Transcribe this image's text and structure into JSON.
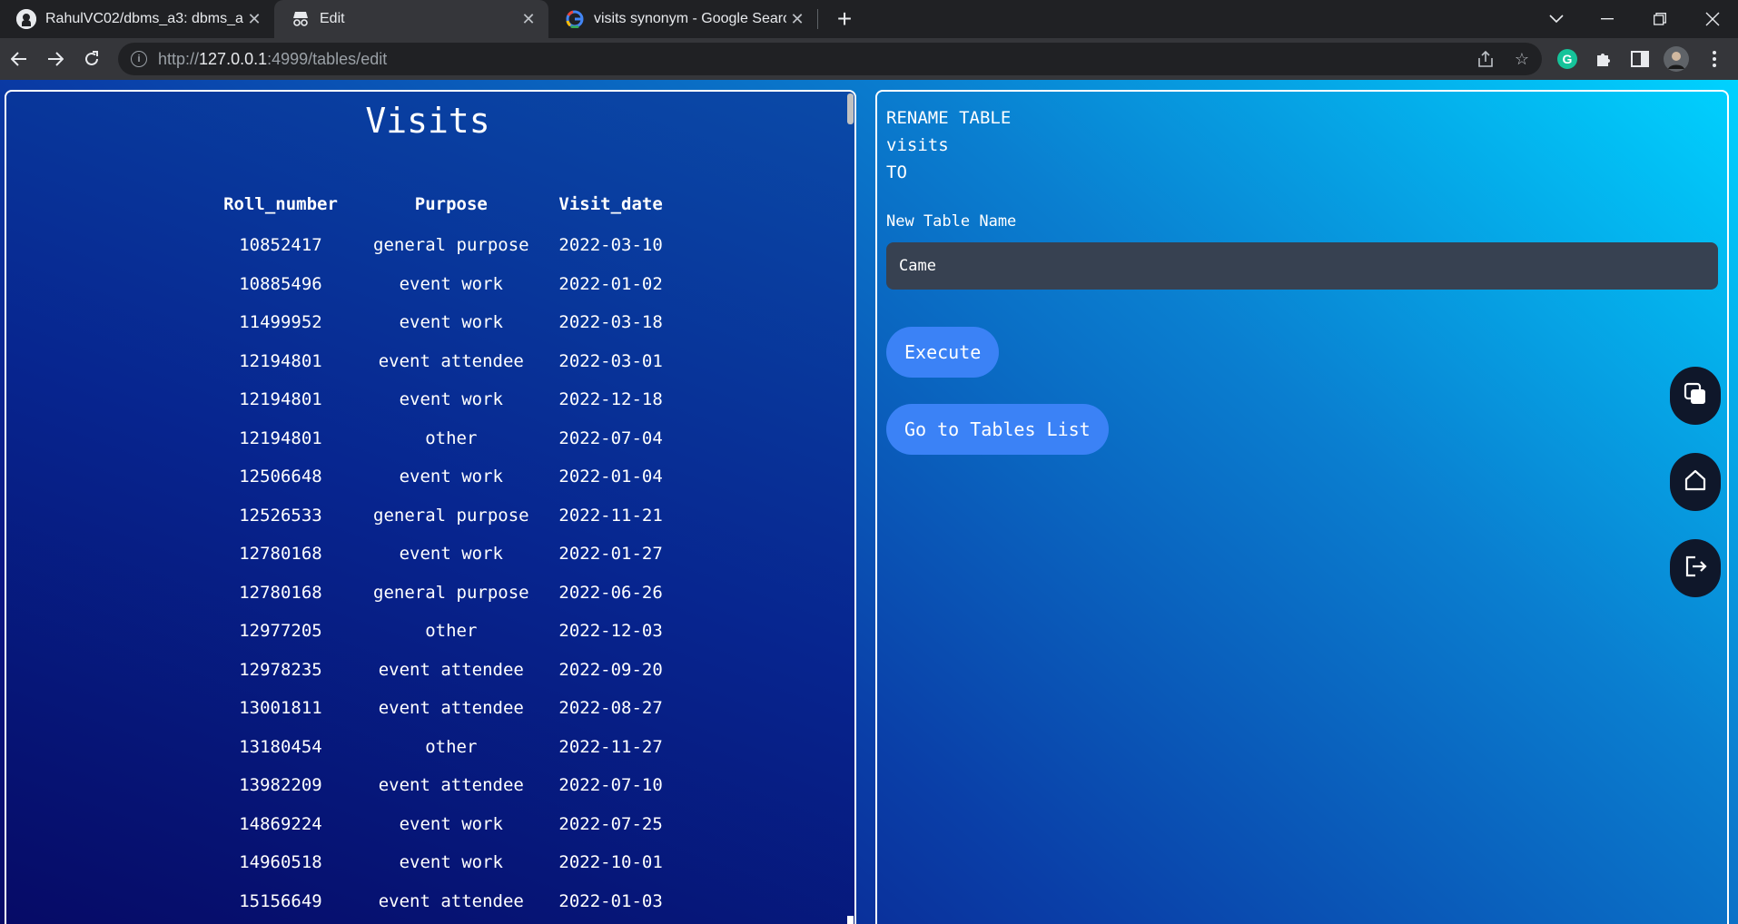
{
  "browser": {
    "tabs": [
      {
        "title": "RahulVC02/dbms_a3: dbms_a3 re",
        "icon": "github-icon",
        "active": false
      },
      {
        "title": "Edit",
        "icon": "incognito-icon",
        "active": true
      },
      {
        "title": "visits synonym - Google Search",
        "icon": "google-icon",
        "active": false
      }
    ],
    "url": {
      "scheme": "http://",
      "host": "127.0.0.1",
      "rest": ":4999/tables/edit"
    }
  },
  "left_panel": {
    "title": "Visits",
    "columns": [
      "Roll_number",
      "Purpose",
      "Visit_date"
    ],
    "rows": [
      [
        "10852417",
        "general purpose",
        "2022-03-10"
      ],
      [
        "10885496",
        "event work",
        "2022-01-02"
      ],
      [
        "11499952",
        "event work",
        "2022-03-18"
      ],
      [
        "12194801",
        "event attendee",
        "2022-03-01"
      ],
      [
        "12194801",
        "event work",
        "2022-12-18"
      ],
      [
        "12194801",
        "other",
        "2022-07-04"
      ],
      [
        "12506648",
        "event work",
        "2022-01-04"
      ],
      [
        "12526533",
        "general purpose",
        "2022-11-21"
      ],
      [
        "12780168",
        "event work",
        "2022-01-27"
      ],
      [
        "12780168",
        "general purpose",
        "2022-06-26"
      ],
      [
        "12977205",
        "other",
        "2022-12-03"
      ],
      [
        "12978235",
        "event attendee",
        "2022-09-20"
      ],
      [
        "13001811",
        "event attendee",
        "2022-08-27"
      ],
      [
        "13180454",
        "other",
        "2022-11-27"
      ],
      [
        "13982209",
        "event attendee",
        "2022-07-10"
      ],
      [
        "14869224",
        "event work",
        "2022-07-25"
      ],
      [
        "14960518",
        "event work",
        "2022-10-01"
      ],
      [
        "15156649",
        "event attendee",
        "2022-01-03"
      ]
    ]
  },
  "right_panel": {
    "sql_lines": [
      "RENAME TABLE",
      "visits",
      "TO"
    ],
    "field_label": "New Table Name",
    "input_value": "Came",
    "execute_label": "Execute",
    "tables_list_label": "Go to Tables List"
  },
  "side_buttons": [
    {
      "icon": "copy-icon"
    },
    {
      "icon": "home-icon"
    },
    {
      "icon": "logout-icon"
    }
  ],
  "colors": {
    "accent_button": "#3b82f6",
    "input_bg": "#374151",
    "fab_bg": "#0f172a"
  }
}
